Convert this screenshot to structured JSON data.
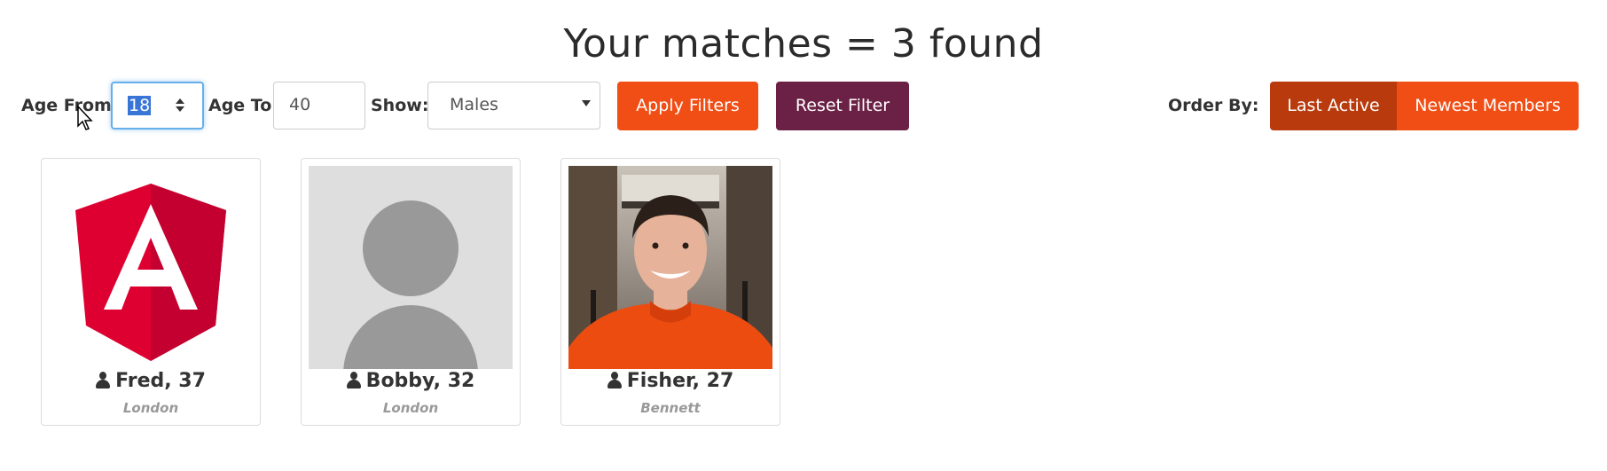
{
  "page": {
    "title": "Your matches = 3 found"
  },
  "filters": {
    "age_from_label": "Age From",
    "age_from_value": "18",
    "age_to_label": "Age To",
    "age_to_value": "40",
    "show_label": "Show:",
    "show_value": "Males",
    "apply_label": "Apply Filters",
    "reset_label": "Reset Filter"
  },
  "order": {
    "label": "Order By:",
    "options": [
      "Last Active",
      "Newest Members"
    ],
    "active": "Last Active"
  },
  "members": [
    {
      "name": "Fred, 37",
      "city": "London",
      "photo": "angular-logo"
    },
    {
      "name": "Bobby, 32",
      "city": "London",
      "photo": "default-avatar"
    },
    {
      "name": "Fisher, 27",
      "city": "Bennett",
      "photo": "man-orange-sweater-photo"
    }
  ],
  "colors": {
    "accent": "#f04e15",
    "accent_active": "#b83a0d",
    "reset": "#6b2145",
    "angular_red": "#dd0031",
    "angular_dark": "#c3002f"
  },
  "icons": [
    "user-icon",
    "mouse-cursor-icon",
    "spinner-icon",
    "dropdown-caret-icon"
  ]
}
